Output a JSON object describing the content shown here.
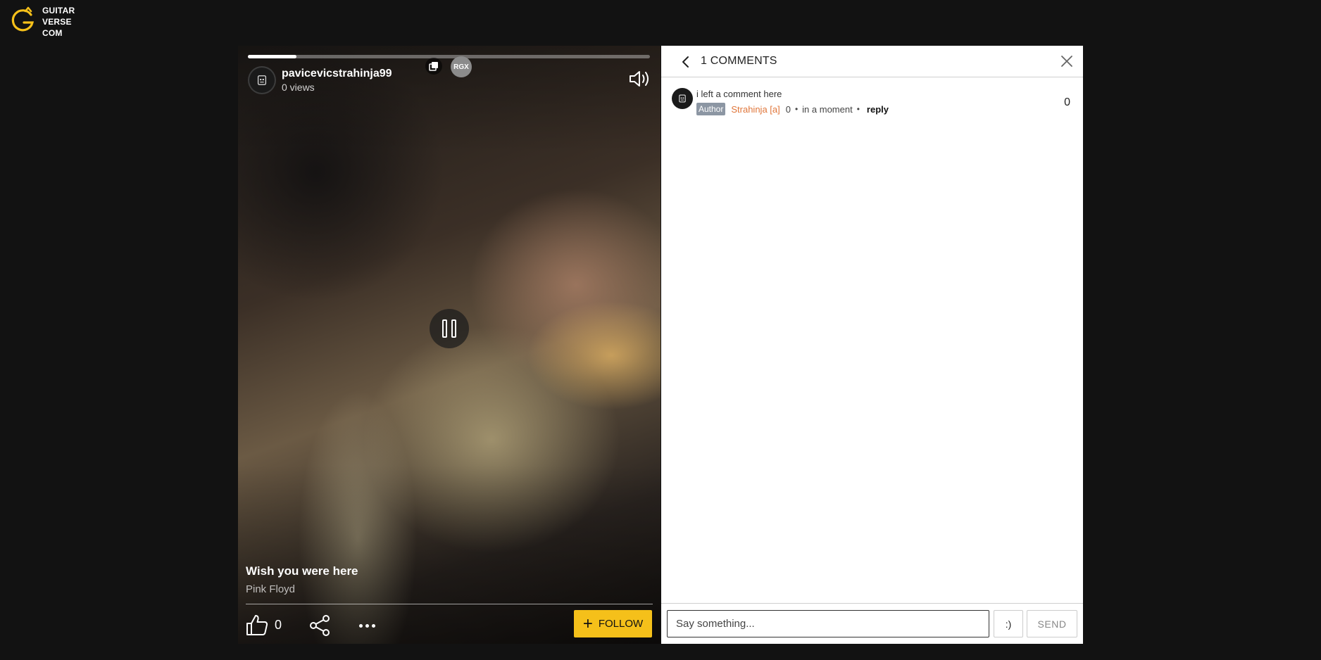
{
  "brand": {
    "name_lines": [
      "GUITAR",
      "VERSE",
      "COM"
    ],
    "logo_icon": "guitarverse-logo",
    "accent_color": "#f5c01a"
  },
  "video": {
    "progress": 0.12,
    "username": "pavicevicstrahinja99",
    "views": "0 views",
    "badge": "RGX",
    "song_title": "Wish you were here",
    "artist": "Pink Floyd",
    "like_count": "0",
    "follow_label": "FOLLOW",
    "icons": {
      "duplicate": "duplicate-icon",
      "volume": "volume-icon",
      "pause": "pause-icon",
      "like": "thumbs-up-icon",
      "share": "share-icon",
      "more": "more-icon"
    }
  },
  "comments": {
    "title": "1 COMMENTS",
    "items": [
      {
        "text": "i left a comment here",
        "badge": "Author",
        "name": "Strahinja [a]",
        "score": "0",
        "time": "in a moment",
        "reply": "reply",
        "likes": "0"
      }
    ],
    "input_placeholder": "Say something...",
    "emoji_label": ":)",
    "send_label": "SEND",
    "name_color": "#e0763a",
    "badge_color": "#8c96a3"
  }
}
